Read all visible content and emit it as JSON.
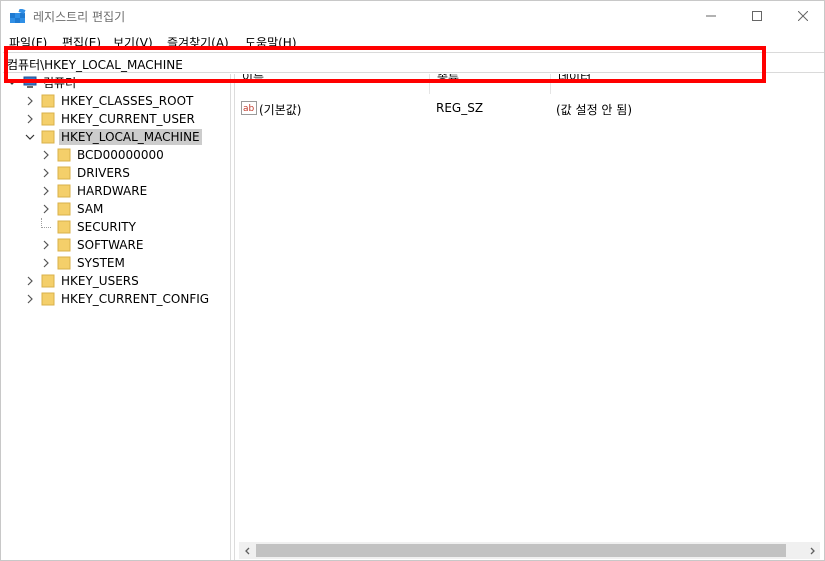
{
  "window": {
    "title": "레지스트리 편집기",
    "minimize_label": "Minimize",
    "maximize_label": "Maximize",
    "close_label": "Close"
  },
  "menu": {
    "items": [
      "파일(F)",
      "편집(E)",
      "보기(V)",
      "즐겨찾기(A)",
      "도움말(H)"
    ]
  },
  "address": {
    "value": "컴퓨터\\HKEY_LOCAL_MACHINE"
  },
  "tree": {
    "root": "컴퓨터",
    "hives": {
      "classes_root": "HKEY_CLASSES_ROOT",
      "current_user": "HKEY_CURRENT_USER",
      "local_machine": "HKEY_LOCAL_MACHINE",
      "users": "HKEY_USERS",
      "current_config": "HKEY_CURRENT_CONFIG"
    },
    "local_machine_children": [
      "BCD00000000",
      "DRIVERS",
      "HARDWARE",
      "SAM",
      "SECURITY",
      "SOFTWARE",
      "SYSTEM"
    ],
    "selected": "HKEY_LOCAL_MACHINE"
  },
  "list": {
    "columns": {
      "name": "이름",
      "type": "종류",
      "data": "데이터"
    },
    "rows": [
      {
        "name": "(기본값)",
        "type": "REG_SZ",
        "data": "(값 설정 안 됨)",
        "icon": "string-value-icon"
      }
    ]
  },
  "colors": {
    "highlight_border": "#ff0000",
    "selection_bg": "#cccccc",
    "folder": "#f4cf6a"
  }
}
